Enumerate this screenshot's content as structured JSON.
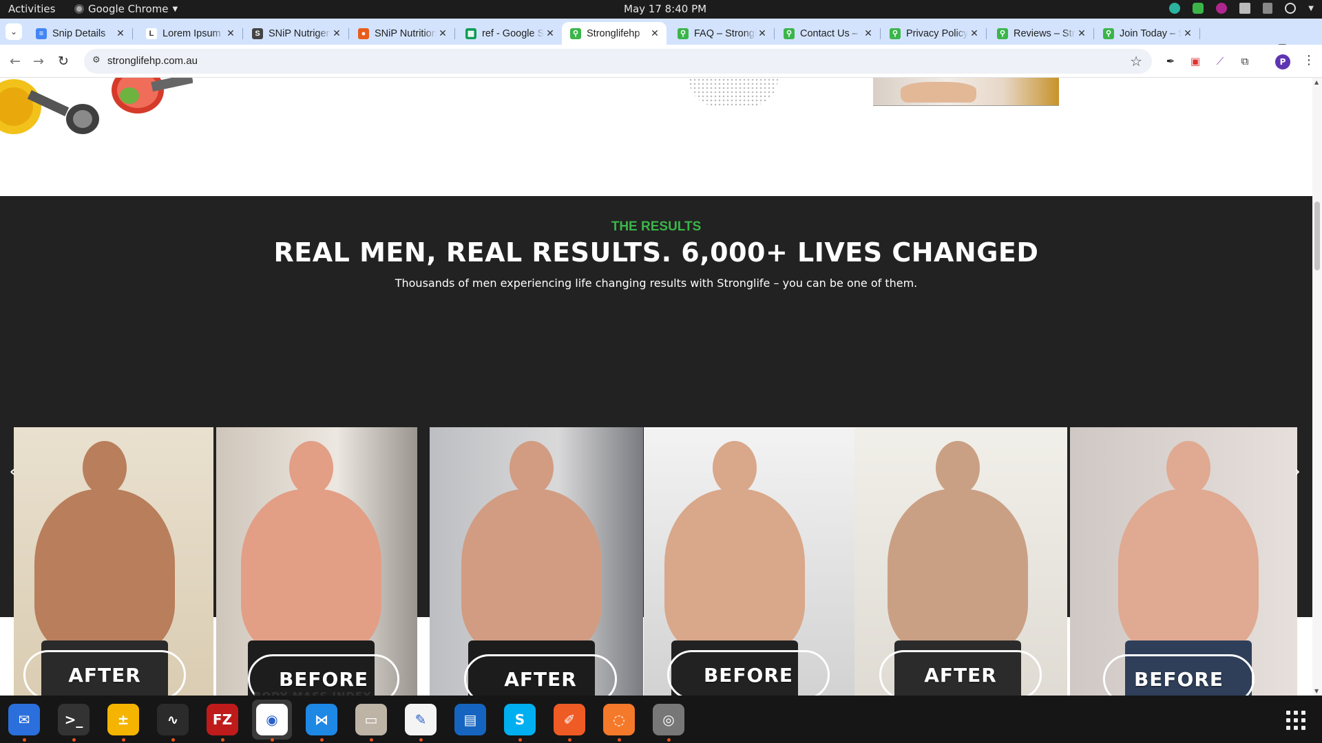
{
  "system_bar": {
    "activities": "Activities",
    "app_name": "Google Chrome",
    "clock": "May 17  8:40 PM"
  },
  "tabs": [
    {
      "title": "Snip Details",
      "favicon": "docs-icon",
      "color": "#4285f4",
      "glyph": "≡"
    },
    {
      "title": "Lorem Ipsum",
      "favicon": "lorem-icon",
      "color": "#ffffff",
      "glyph": "L"
    },
    {
      "title": "SNiP Nutrigenomics",
      "favicon": "snip-icon",
      "color": "#444444",
      "glyph": "S"
    },
    {
      "title": "SNiP Nutrition",
      "favicon": "snip-fruit-icon",
      "color": "#e85c1c",
      "glyph": "●"
    },
    {
      "title": "ref - Google Sheets",
      "favicon": "sheets-icon",
      "color": "#0f9d58",
      "glyph": "▦"
    },
    {
      "title": "Stronglifehp",
      "favicon": "stronglife-icon",
      "color": "#3bb54a",
      "glyph": "⚲"
    },
    {
      "title": "FAQ – Stronglife",
      "favicon": "stronglife-icon",
      "color": "#3bb54a",
      "glyph": "⚲"
    },
    {
      "title": "Contact Us – Stronglife",
      "favicon": "stronglife-icon",
      "color": "#3bb54a",
      "glyph": "⚲"
    },
    {
      "title": "Privacy Policy",
      "favicon": "stronglife-icon",
      "color": "#3bb54a",
      "glyph": "⚲"
    },
    {
      "title": "Reviews – Stronglife",
      "favicon": "stronglife-icon",
      "color": "#3bb54a",
      "glyph": "⚲"
    },
    {
      "title": "Join Today – Stronglife",
      "favicon": "stronglife-icon",
      "color": "#3bb54a",
      "glyph": "⚲"
    }
  ],
  "active_tab_index": 5,
  "omnibox": {
    "url": "stronglifehp.com.au"
  },
  "page": {
    "eyebrow": "THE RESULTS",
    "heading": "REAL MEN, REAL RESULTS. 6,000+ LIVES CHANGED",
    "subheading": "Thousands of men experiencing life changing results with Stronglife – you can be one of them.",
    "section_label": "BODY MASS INDEX",
    "accent": "#3bb54a",
    "section_bg": "#222222"
  },
  "carousel": {
    "slides": [
      {
        "label": "AFTER",
        "name": "result-photo-1"
      },
      {
        "label": "BEFORE",
        "name": "result-photo-2"
      },
      {
        "label": "AFTER",
        "name": "result-photo-3"
      },
      {
        "label": "BEFORE",
        "name": "result-photo-4"
      },
      {
        "label": "AFTER",
        "name": "result-photo-5"
      },
      {
        "label": "BEFORE",
        "name": "result-photo-6"
      }
    ]
  },
  "dock": [
    {
      "name": "thunderbird-icon",
      "color": "#2a6fdb",
      "glyph": "✉",
      "running": true
    },
    {
      "name": "terminal-icon",
      "color": "#333333",
      "glyph": ">_",
      "running": true
    },
    {
      "name": "calculator-icon",
      "color": "#f5b400",
      "glyph": "±",
      "running": true
    },
    {
      "name": "system-monitor-icon",
      "color": "#2b2b2b",
      "glyph": "∿",
      "running": true
    },
    {
      "name": "filezilla-icon",
      "color": "#bf1b1b",
      "glyph": "FZ",
      "running": true
    },
    {
      "name": "chrome-icon",
      "color": "#ffffff",
      "glyph": "◉",
      "running": true
    },
    {
      "name": "vscode-icon",
      "color": "#1e88e5",
      "glyph": "⋈",
      "running": true
    },
    {
      "name": "files-icon",
      "color": "#bdb4a6",
      "glyph": "▭",
      "running": true
    },
    {
      "name": "text-editor-icon",
      "color": "#f4f4f4",
      "glyph": "✎",
      "running": true
    },
    {
      "name": "document-viewer-icon",
      "color": "#1565c0",
      "glyph": "▤",
      "running": false
    },
    {
      "name": "skype-icon",
      "color": "#00aff0",
      "glyph": "S",
      "running": true
    },
    {
      "name": "postman-icon",
      "color": "#ef5b25",
      "glyph": "✐",
      "running": true
    },
    {
      "name": "blender-icon",
      "color": "#f5792a",
      "glyph": "◌",
      "running": true
    },
    {
      "name": "disk-icon",
      "color": "#777777",
      "glyph": "◎",
      "running": true
    }
  ]
}
